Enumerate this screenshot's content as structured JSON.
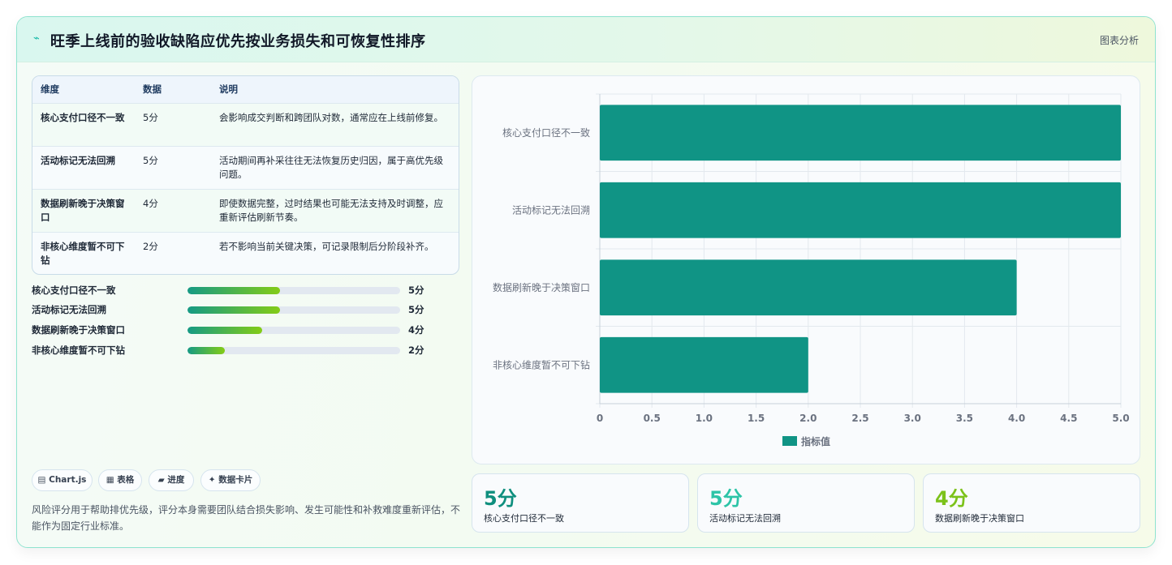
{
  "header": {
    "title": "旺季上线前的验收缺陷应优先按业务损失和可恢复性排序",
    "link_label": "图表分析",
    "icon": "spark-icon"
  },
  "table": {
    "columns": [
      "维度",
      "数据",
      "说明"
    ],
    "rows": [
      {
        "dim": "核心支付口径不一致",
        "value": "5分",
        "desc": "会影响成交判断和跨团队对数，通常应在上线前修复。"
      },
      {
        "dim": "活动标记无法回溯",
        "value": "5分",
        "desc": "活动期间再补采往往无法恢复历史归因，属于高优先级问题。"
      },
      {
        "dim": "数据刷新晚于决策窗口",
        "value": "4分",
        "desc": "即使数据完整，过时结果也可能无法支持及时调整，应重新评估刷新节奏。"
      },
      {
        "dim": "非核心维度暂不可下钻",
        "value": "2分",
        "desc": "若不影响当前关键决策，可记录限制后分阶段补齐。"
      }
    ]
  },
  "progress": [
    {
      "label": "核心支付口径不一致",
      "value_text": "5分",
      "fraction": 0.435
    },
    {
      "label": "活动标记无法回溯",
      "value_text": "5分",
      "fraction": 0.435
    },
    {
      "label": "数据刷新晚于决策窗口",
      "value_text": "4分",
      "fraction": 0.35
    },
    {
      "label": "非核心维度暂不可下钻",
      "value_text": "2分",
      "fraction": 0.175
    }
  ],
  "tags": [
    "▤ Chart.js",
    "▦ 表格",
    "▰ 进度",
    "✦ 数据卡片"
  ],
  "note": "风险评分用于帮助排优先级，评分本身需要团队结合损失影响、发生可能性和补救难度重新评估，不能作为固定行业标准。",
  "chart_data": {
    "type": "bar",
    "orientation": "horizontal",
    "categories": [
      "核心支付口径不一致",
      "活动标记无法回溯",
      "数据刷新晚于决策窗口",
      "非核心维度暂不可下钻"
    ],
    "series": [
      {
        "name": "指标值",
        "values": [
          5,
          5,
          4,
          2
        ]
      }
    ],
    "xlim": [
      0,
      5
    ],
    "xticks": [
      "0",
      "0.5",
      "1.0",
      "1.5",
      "2.0",
      "2.5",
      "3.0",
      "3.5",
      "4.0",
      "4.5",
      "5.0"
    ],
    "grid": true,
    "legend": "bottom",
    "bar_color": "#109485"
  },
  "kpis": [
    {
      "value": "5分",
      "label": "核心支付口径不一致",
      "color": "#0f8f7e"
    },
    {
      "value": "5分",
      "label": "活动标记无法回溯",
      "color": "#2cc4a7"
    },
    {
      "value": "4分",
      "label": "数据刷新晚于决策窗口",
      "color": "#7cc21a"
    }
  ]
}
